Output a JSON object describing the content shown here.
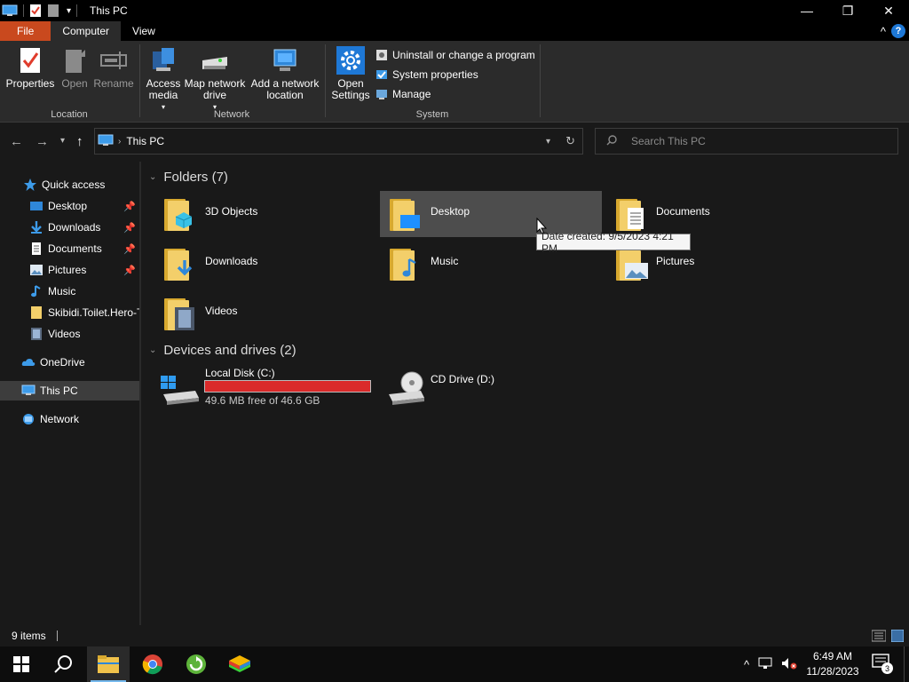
{
  "window": {
    "title": "This PC",
    "minimize_glyph": "—",
    "maximize_glyph": "❐",
    "close_glyph": "✕"
  },
  "ribbon_tabs": [
    {
      "label": "File"
    },
    {
      "label": "Computer"
    },
    {
      "label": "View"
    }
  ],
  "help_glyph": "?",
  "collapse_glyph": "^",
  "ribbon": {
    "location_group": "Location",
    "network_group": "Network",
    "system_group": "System",
    "properties": "Properties",
    "open": "Open",
    "rename": "Rename",
    "access_media": "Access media",
    "map_network_drive": "Map network drive",
    "add_network_location": "Add a network location",
    "open_settings": "Open Settings",
    "uninstall": "Uninstall or change a program",
    "system_properties": "System properties",
    "manage": "Manage"
  },
  "address": {
    "path": "This PC",
    "search_placeholder": "Search This PC"
  },
  "nav": {
    "quick_access": "Quick access",
    "items": [
      {
        "label": "Desktop",
        "pinned": true
      },
      {
        "label": "Downloads",
        "pinned": true
      },
      {
        "label": "Documents",
        "pinned": true
      },
      {
        "label": "Pictures",
        "pinned": true
      },
      {
        "label": "Music",
        "pinned": false
      },
      {
        "label": "Skibidi.Toilet.Hero-T",
        "pinned": false
      },
      {
        "label": "Videos",
        "pinned": false
      }
    ],
    "onedrive": "OneDrive",
    "this_pc": "This PC",
    "network": "Network"
  },
  "content": {
    "folders_header": "Folders (7)",
    "folders": [
      {
        "name": "3D Objects"
      },
      {
        "name": "Desktop"
      },
      {
        "name": "Documents"
      },
      {
        "name": "Downloads"
      },
      {
        "name": "Music"
      },
      {
        "name": "Pictures"
      },
      {
        "name": "Videos"
      }
    ],
    "devices_header": "Devices and drives (2)",
    "drives": [
      {
        "name": "Local Disk (C:)",
        "free": "49.6 MB free of 46.6 GB",
        "used_fraction": 0.999
      },
      {
        "name": "CD Drive (D:)"
      }
    ],
    "tooltip": "Date created: 9/5/2023 4:21 PM"
  },
  "status": {
    "items": "9 items"
  },
  "taskbar": {
    "time": "6:49 AM",
    "date": "11/28/2023",
    "notification_count": "3"
  },
  "colors": {
    "file_tab": "#c9491e",
    "drive_bar_full": "#da2a2a",
    "accent": "#1e78d6",
    "folder": "#f3cf6a"
  }
}
